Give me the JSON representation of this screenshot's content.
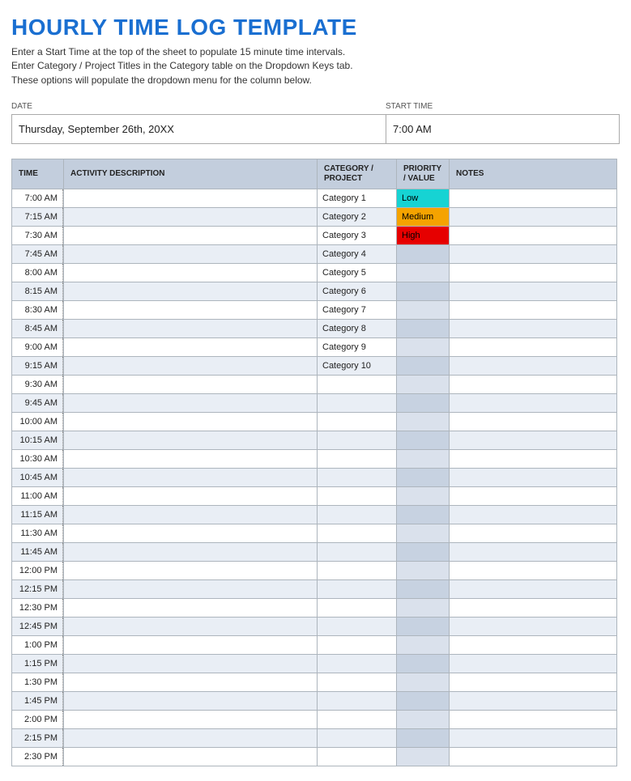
{
  "title": "HOURLY TIME LOG TEMPLATE",
  "instructions": [
    "Enter a Start Time at the top of the sheet to populate 15 minute time intervals.",
    "Enter Category / Project Titles in the Category table on the Dropdown Keys tab.",
    "These options will populate the dropdown menu for the column below."
  ],
  "meta": {
    "date_label": "DATE",
    "date_value": "Thursday, September 26th, 20XX",
    "start_label": "START TIME",
    "start_value": "7:00 AM"
  },
  "columns": {
    "time": "TIME",
    "activity": "ACTIVITY DESCRIPTION",
    "category": "CATEGORY / PROJECT",
    "priority": "PRIORITY / VALUE",
    "notes": "NOTES"
  },
  "priority_colors": {
    "Low": "pri-low",
    "Medium": "pri-med",
    "High": "pri-high"
  },
  "rows": [
    {
      "time": "7:00 AM",
      "activity": "",
      "category": "Category 1",
      "priority": "Low",
      "notes": ""
    },
    {
      "time": "7:15 AM",
      "activity": "",
      "category": "Category 2",
      "priority": "Medium",
      "notes": ""
    },
    {
      "time": "7:30 AM",
      "activity": "",
      "category": "Category 3",
      "priority": "High",
      "notes": ""
    },
    {
      "time": "7:45 AM",
      "activity": "",
      "category": "Category 4",
      "priority": "",
      "notes": ""
    },
    {
      "time": "8:00 AM",
      "activity": "",
      "category": "Category 5",
      "priority": "",
      "notes": ""
    },
    {
      "time": "8:15 AM",
      "activity": "",
      "category": "Category 6",
      "priority": "",
      "notes": ""
    },
    {
      "time": "8:30 AM",
      "activity": "",
      "category": "Category 7",
      "priority": "",
      "notes": ""
    },
    {
      "time": "8:45 AM",
      "activity": "",
      "category": "Category 8",
      "priority": "",
      "notes": ""
    },
    {
      "time": "9:00 AM",
      "activity": "",
      "category": "Category 9",
      "priority": "",
      "notes": ""
    },
    {
      "time": "9:15 AM",
      "activity": "",
      "category": "Category 10",
      "priority": "",
      "notes": ""
    },
    {
      "time": "9:30 AM",
      "activity": "",
      "category": "",
      "priority": "",
      "notes": ""
    },
    {
      "time": "9:45 AM",
      "activity": "",
      "category": "",
      "priority": "",
      "notes": ""
    },
    {
      "time": "10:00 AM",
      "activity": "",
      "category": "",
      "priority": "",
      "notes": ""
    },
    {
      "time": "10:15 AM",
      "activity": "",
      "category": "",
      "priority": "",
      "notes": ""
    },
    {
      "time": "10:30 AM",
      "activity": "",
      "category": "",
      "priority": "",
      "notes": ""
    },
    {
      "time": "10:45 AM",
      "activity": "",
      "category": "",
      "priority": "",
      "notes": ""
    },
    {
      "time": "11:00 AM",
      "activity": "",
      "category": "",
      "priority": "",
      "notes": ""
    },
    {
      "time": "11:15 AM",
      "activity": "",
      "category": "",
      "priority": "",
      "notes": ""
    },
    {
      "time": "11:30 AM",
      "activity": "",
      "category": "",
      "priority": "",
      "notes": ""
    },
    {
      "time": "11:45 AM",
      "activity": "",
      "category": "",
      "priority": "",
      "notes": ""
    },
    {
      "time": "12:00 PM",
      "activity": "",
      "category": "",
      "priority": "",
      "notes": ""
    },
    {
      "time": "12:15 PM",
      "activity": "",
      "category": "",
      "priority": "",
      "notes": ""
    },
    {
      "time": "12:30 PM",
      "activity": "",
      "category": "",
      "priority": "",
      "notes": ""
    },
    {
      "time": "12:45 PM",
      "activity": "",
      "category": "",
      "priority": "",
      "notes": ""
    },
    {
      "time": "1:00 PM",
      "activity": "",
      "category": "",
      "priority": "",
      "notes": ""
    },
    {
      "time": "1:15 PM",
      "activity": "",
      "category": "",
      "priority": "",
      "notes": ""
    },
    {
      "time": "1:30 PM",
      "activity": "",
      "category": "",
      "priority": "",
      "notes": ""
    },
    {
      "time": "1:45 PM",
      "activity": "",
      "category": "",
      "priority": "",
      "notes": ""
    },
    {
      "time": "2:00 PM",
      "activity": "",
      "category": "",
      "priority": "",
      "notes": ""
    },
    {
      "time": "2:15 PM",
      "activity": "",
      "category": "",
      "priority": "",
      "notes": ""
    },
    {
      "time": "2:30 PM",
      "activity": "",
      "category": "",
      "priority": "",
      "notes": ""
    }
  ]
}
